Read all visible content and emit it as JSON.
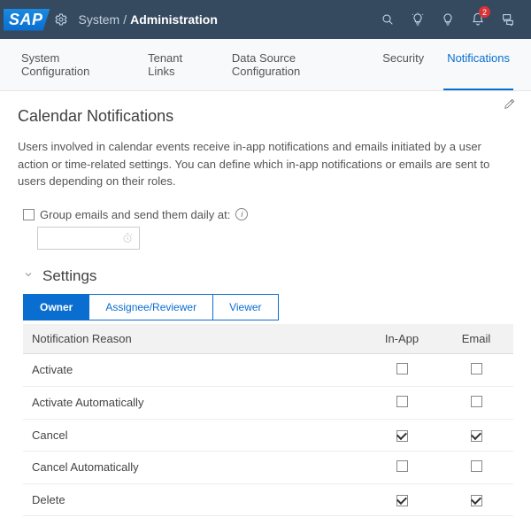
{
  "header": {
    "logo_text": "SAP",
    "breadcrumb_parent": "System",
    "breadcrumb_sep": "/",
    "breadcrumb_current": "Administration",
    "badge_count": "2"
  },
  "tabs": [
    {
      "label": "System Configuration",
      "active": false
    },
    {
      "label": "Tenant Links",
      "active": false
    },
    {
      "label": "Data Source Configuration",
      "active": false
    },
    {
      "label": "Security",
      "active": false
    },
    {
      "label": "Notifications",
      "active": true
    }
  ],
  "page": {
    "title": "Calendar Notifications",
    "description": "Users involved in calendar events receive in-app notifications and emails initiated by a user action or time-related settings. You can define which in-app notifications or emails are sent to users depending on their roles.",
    "group_label": "Group emails and send them daily at:",
    "time_value": ""
  },
  "section": {
    "title": "Settings",
    "segments": [
      {
        "label": "Owner",
        "active": true
      },
      {
        "label": "Assignee/Reviewer",
        "active": false
      },
      {
        "label": "Viewer",
        "active": false
      }
    ],
    "columns": {
      "reason": "Notification Reason",
      "inapp": "In-App",
      "email": "Email"
    },
    "rows": [
      {
        "reason": "Activate",
        "inapp": false,
        "email": false
      },
      {
        "reason": "Activate Automatically",
        "inapp": false,
        "email": false
      },
      {
        "reason": "Cancel",
        "inapp": true,
        "email": true
      },
      {
        "reason": "Cancel Automatically",
        "inapp": false,
        "email": false
      },
      {
        "reason": "Delete",
        "inapp": true,
        "email": true
      }
    ]
  }
}
